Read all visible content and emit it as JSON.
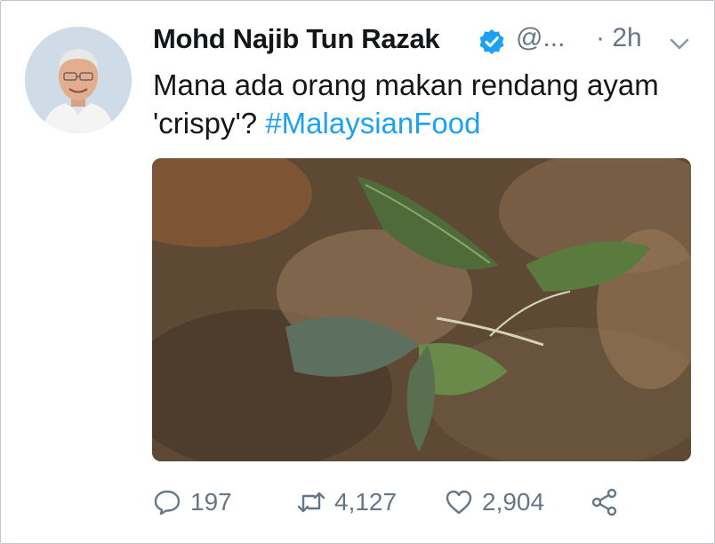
{
  "tweet": {
    "author_name": "Mohd Najib Tun Razak",
    "handle": "@...",
    "time": "· 2h",
    "text_main": "Mana ada orang makan rendang ayam 'crispy'?",
    "hashtag": "#MalaysianFood"
  },
  "stats": {
    "replies": "197",
    "retweets": "4,127",
    "likes": "2,904"
  },
  "icons": {
    "verified": "verified-badge-icon",
    "caret": "chevron-down-icon",
    "reply": "reply-icon",
    "retweet": "retweet-icon",
    "like": "heart-icon",
    "share": "share-icon"
  },
  "colors": {
    "accent": "#1da1f2",
    "secondary_text": "#657786",
    "primary_text": "#14171a"
  }
}
